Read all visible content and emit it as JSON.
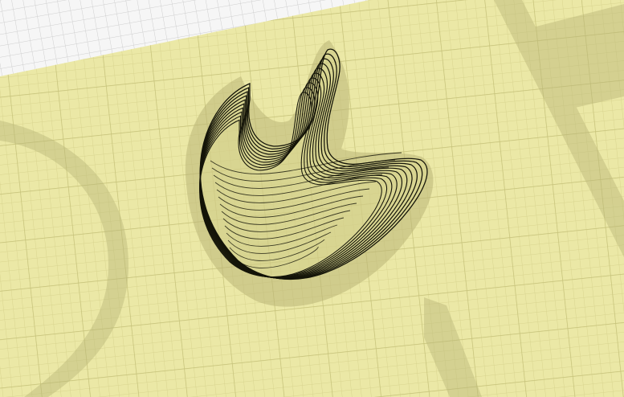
{
  "viewport": {
    "mode": "3d-print-layer-preview",
    "background_color": "#f6f6f6",
    "bed_color": "#ebe8a6",
    "grid_minor_color": "#d9d58f",
    "grid_major_color": "#cbc77c",
    "shadow_color": "#b9b577",
    "contour_color": "#141408",
    "contour_fill_color": "#e8e49a",
    "contour_layers_visible": 10
  },
  "icons": {
    "model": "sliced-model-contours-icon"
  }
}
